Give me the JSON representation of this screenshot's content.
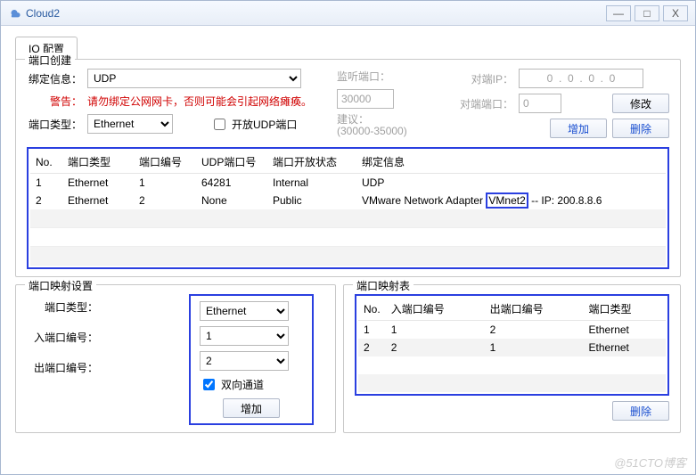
{
  "window": {
    "title": "Cloud2",
    "min": "—",
    "max": "□",
    "close": "X"
  },
  "tab": {
    "io_config": "IO 配置"
  },
  "port_create": {
    "legend": "端口创建",
    "bind_label": "绑定信息：",
    "bind_value": "UDP",
    "warn_prefix": "警告：",
    "warn_text": "请勿绑定公网网卡，否则可能会引起网络瘫痪。",
    "type_label": "端口类型：",
    "type_value": "Ethernet",
    "open_udp": "开放UDP端口",
    "open_udp_checked": false,
    "listen_label": "监听端口：",
    "listen_value": "30000",
    "suggest_label": "建议：",
    "suggest_range": "(30000-35000)",
    "peer_ip_label": "对端IP：",
    "peer_ip_value": "0  .  0  .  0  .  0",
    "peer_port_label": "对端端口：",
    "peer_port_value": "0",
    "modify": "修改",
    "add": "增加",
    "delete": "删除",
    "cols": {
      "no": "No.",
      "ptype": "端口类型",
      "pnum": "端口编号",
      "udp": "UDP端口号",
      "open": "端口开放状态",
      "bind": "绑定信息"
    },
    "rows": [
      {
        "no": "1",
        "ptype": "Ethernet",
        "pnum": "1",
        "udp": "64281",
        "open": "Internal",
        "bind": "UDP"
      },
      {
        "no": "2",
        "ptype": "Ethernet",
        "pnum": "2",
        "udp": "None",
        "open": "Public",
        "bind_pre": "VMware Network Adapter ",
        "bind_hl": "VMnet2",
        "bind_post": " -- IP: 200.8.8.6"
      }
    ]
  },
  "map_set": {
    "legend": "端口映射设置",
    "type_label": "端口类型：",
    "type_value": "Ethernet",
    "in_label": "入端口编号：",
    "in_value": "1",
    "out_label": "出端口编号：",
    "out_value": "2",
    "bidir": "双向通道",
    "bidir_checked": true,
    "add": "增加"
  },
  "map_tbl": {
    "legend": "端口映射表",
    "cols": {
      "no": "No.",
      "in": "入端口编号",
      "out": "出端口编号",
      "type": "端口类型"
    },
    "rows": [
      {
        "no": "1",
        "in": "1",
        "out": "2",
        "type": "Ethernet"
      },
      {
        "no": "2",
        "in": "2",
        "out": "1",
        "type": "Ethernet"
      }
    ],
    "delete": "删除"
  },
  "watermark": "@51CTO博客"
}
